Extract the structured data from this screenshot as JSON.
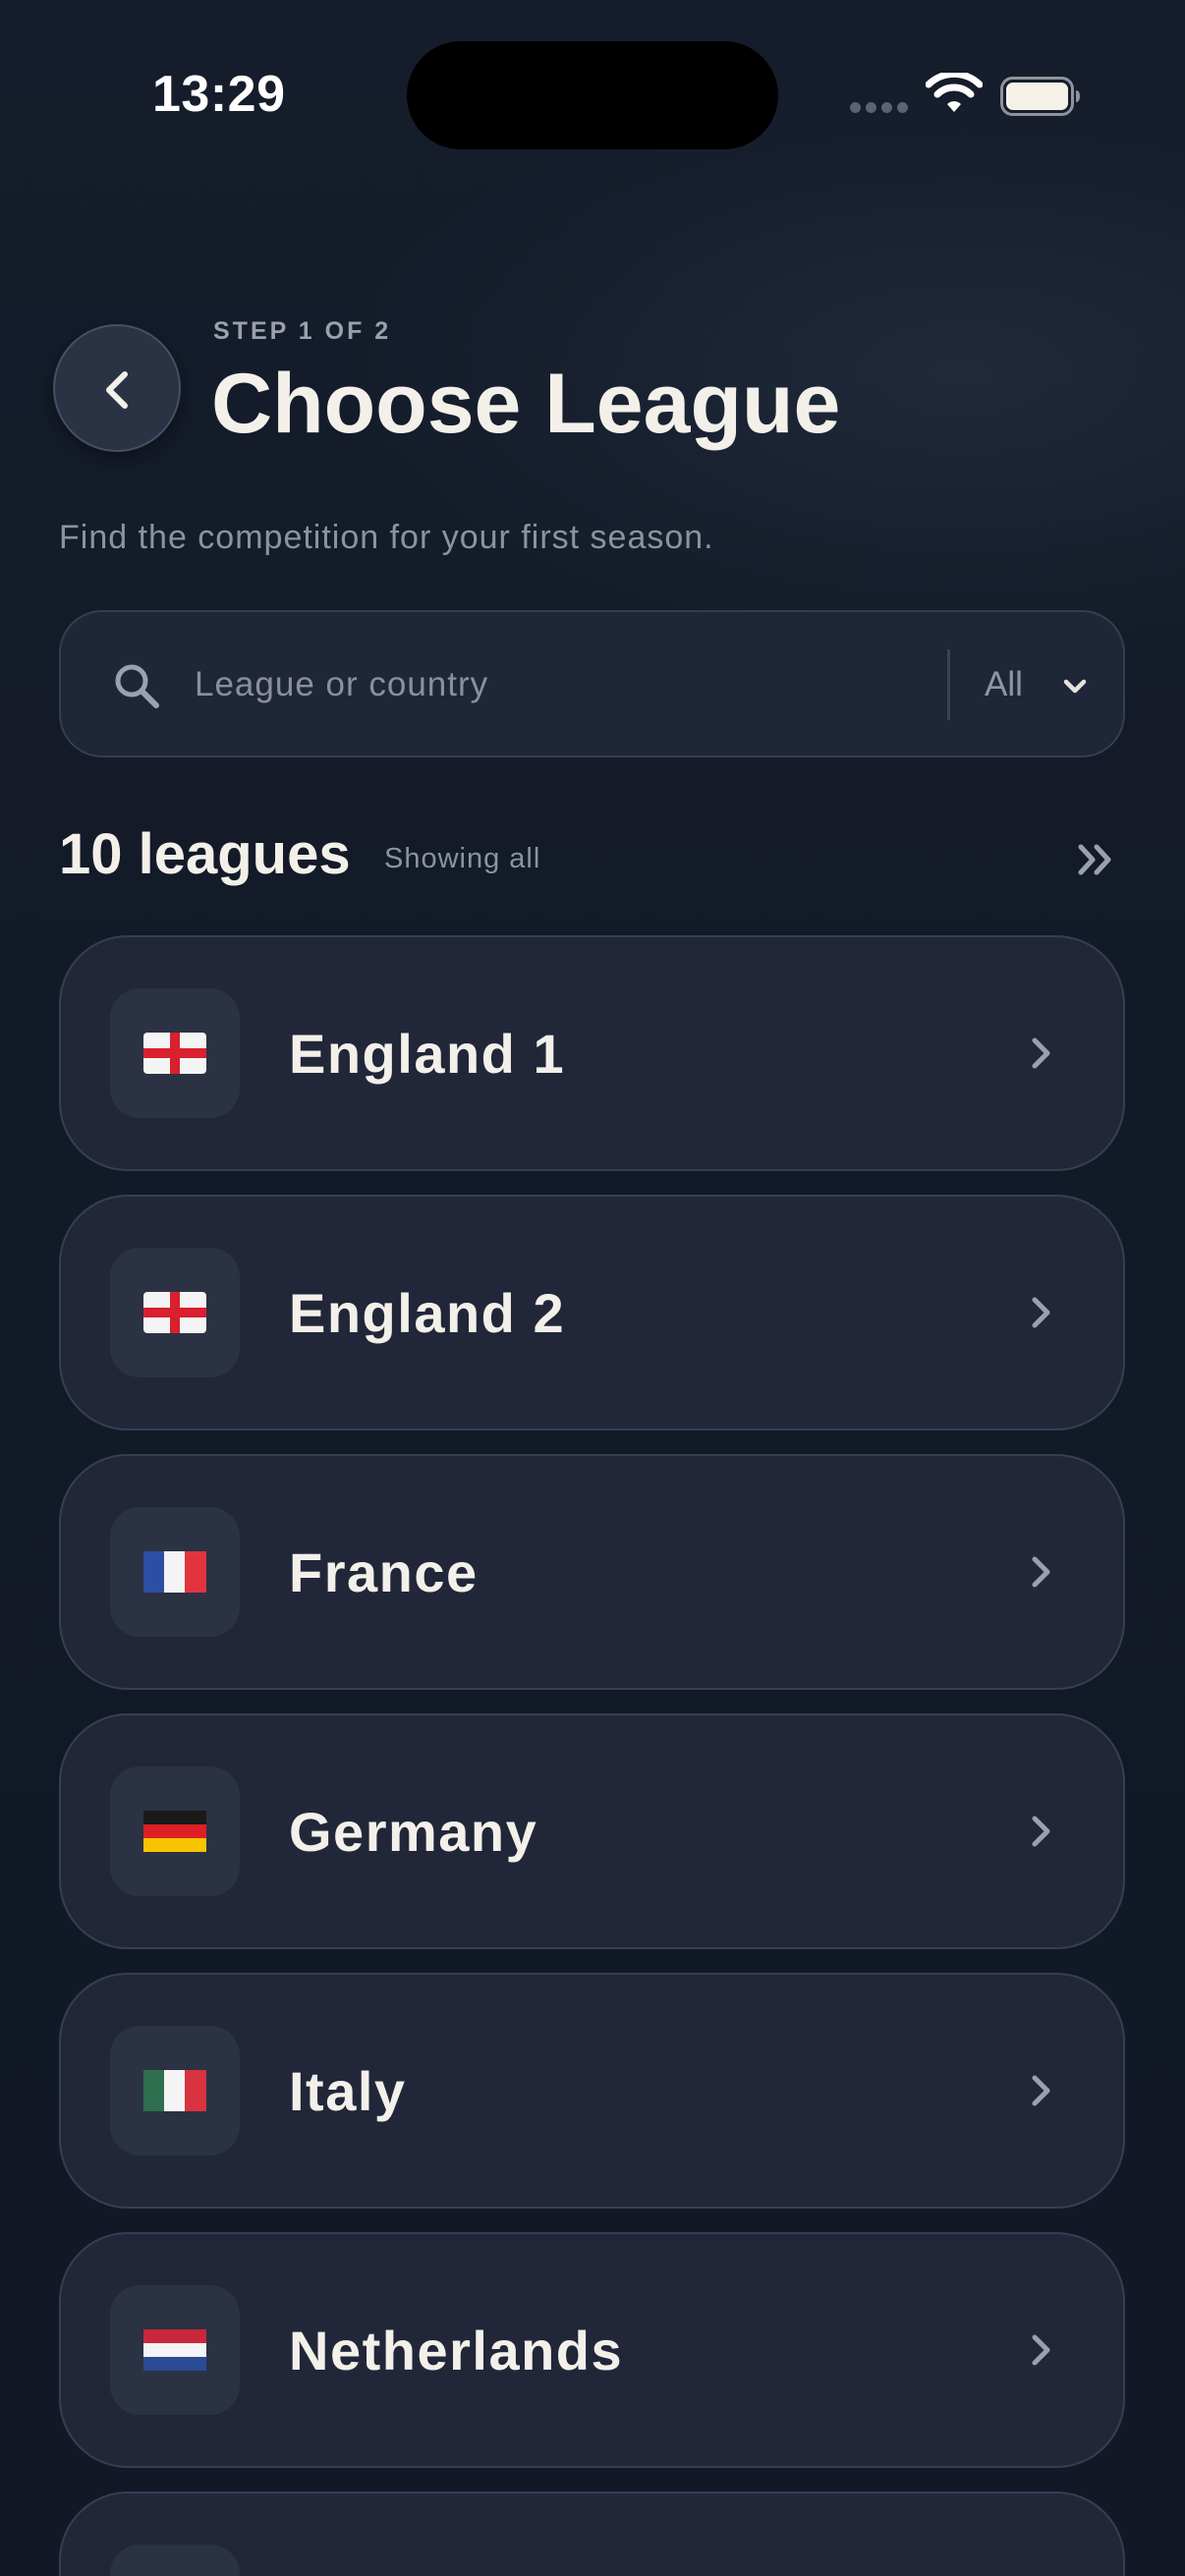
{
  "status_bar": {
    "time": "13:29"
  },
  "header": {
    "step_label": "STEP 1 OF 2",
    "title": "Choose League",
    "subtitle": "Find the competition for your first season."
  },
  "search": {
    "placeholder": "League or country",
    "value": "",
    "filter_value": "All"
  },
  "list_header": {
    "count_label": "10 leagues",
    "status_label": "Showing all"
  },
  "leagues": [
    {
      "name": "England 1",
      "flag": "england-flag-icon"
    },
    {
      "name": "England 2",
      "flag": "england-flag-icon"
    },
    {
      "name": "France",
      "flag": "france-flag-icon"
    },
    {
      "name": "Germany",
      "flag": "germany-flag-icon"
    },
    {
      "name": "Italy",
      "flag": "italy-flag-icon"
    },
    {
      "name": "Netherlands",
      "flag": "netherlands-flag-icon"
    }
  ],
  "colors": {
    "background": "#131a27",
    "card": "#212739",
    "card_border": "#363f52",
    "text_primary": "#f3f0ea",
    "text_secondary": "#8c93a0"
  }
}
